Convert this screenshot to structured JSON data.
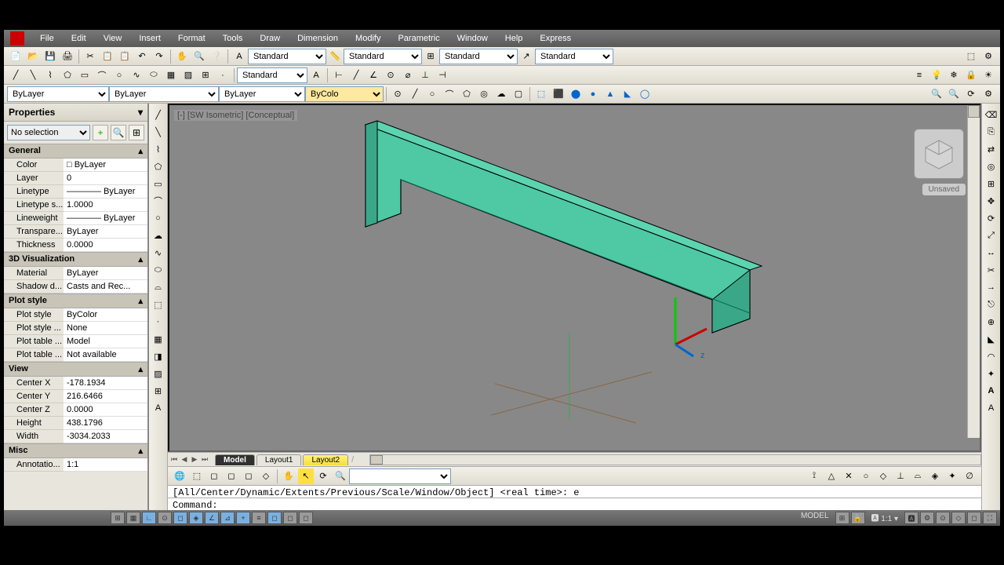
{
  "menu": [
    "File",
    "Edit",
    "View",
    "Insert",
    "Format",
    "Tools",
    "Draw",
    "Dimension",
    "Modify",
    "Parametric",
    "Window",
    "Help",
    "Express"
  ],
  "styles": {
    "text": "Standard",
    "dim": "Standard",
    "table": "Standard",
    "mleader": "Standard",
    "layer": "ByLayer",
    "ltype": "ByLayer",
    "lweight": "ByLayer",
    "color": "ByColo",
    "textstyle": "Standard"
  },
  "view_label": "[-] [SW Isometric] [Conceptual]",
  "unsaved": "Unsaved",
  "props": {
    "title": "Properties",
    "sel": "No selection",
    "general": {
      "hdr": "General",
      "rows": {
        "Color": "□ ByLayer",
        "Layer": "0",
        "Linetype": "———— ByLayer",
        "Linetype s...": "1.0000",
        "Lineweight": "———— ByLayer",
        "Transpare...": "ByLayer",
        "Thickness": "0.0000"
      }
    },
    "viz": {
      "hdr": "3D Visualization",
      "rows": {
        "Material": "ByLayer",
        "Shadow d...": "Casts and Rec..."
      }
    },
    "plot": {
      "hdr": "Plot style",
      "rows": {
        "Plot style": "ByColor",
        "Plot style ...": "None",
        "Plot table ...": "Model",
        "Plot table ...  ": "Not available"
      }
    },
    "view": {
      "hdr": "View",
      "rows": {
        "Center X": "-178.1934",
        "Center Y": "216.6466",
        "Center Z": "0.0000",
        "Height": "438.1796",
        "Width": "-3034.2033"
      }
    },
    "misc": {
      "hdr": "Misc",
      "rows": {
        "Annotatio...": "1:1"
      }
    }
  },
  "tabs": [
    "Model",
    "Layout1",
    "Layout2"
  ],
  "cmd_hist": "[All/Center/Dynamic/Extents/Previous/Scale/Window/Object] <real time>: e",
  "cmd_prompt": "Command:",
  "status": {
    "space": "MODEL",
    "scale": "1:1"
  }
}
